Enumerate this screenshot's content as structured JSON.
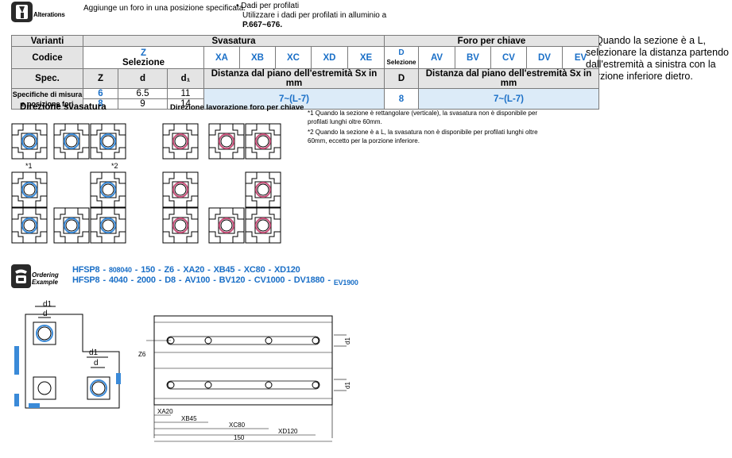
{
  "header": {
    "alterations_label": "Alterations",
    "description": "Aggiunge un foro in una posizione specificata.",
    "bullet_line1": "• Dadi per profilati",
    "bullet_line2": "Utilizzare i dadi per profilati in alluminio a",
    "bullet_line3": "P.667~676."
  },
  "side_note": {
    "icon": "question-icon",
    "text": "Quando la sezione è a L, selezionare la distanza partendo dall'estremità a sinistra con la porzione inferiore dietro."
  },
  "table": {
    "varianti": "Varianti",
    "svasatura": "Svasatura",
    "foro": "Foro per chiave",
    "codice": "Codice",
    "z": "Z",
    "selezione": "Selezione",
    "codes_sv": [
      "XA",
      "XB",
      "XC",
      "XD",
      "XE"
    ],
    "d": "D",
    "selezione_small": "Selezione",
    "codes_fk": [
      "AV",
      "BV",
      "CV",
      "DV",
      "EV"
    ],
    "spec": "Spec.",
    "col_z": "Z",
    "col_d": "d",
    "col_d1": "d₁",
    "dist_sv": "Distanza dal piano dell'estremità Sx in mm",
    "col_D": "D",
    "dist_fk": "Distanza dal piano dell'estremità Sx in mm",
    "spec_label1": "Specifiche di misura",
    "spec_label2": "e posizione fori",
    "rows": [
      {
        "z": "6",
        "d": "6.5",
        "d1": "11"
      },
      {
        "z": "8",
        "d": "9",
        "d1": "14"
      }
    ],
    "range_sv": "7~(L-7)",
    "D_val": "8",
    "range_fk": "7~(L-7)"
  },
  "sections": {
    "dir_sv": "Direzione svasatura",
    "dir_fk": "Direzione lavorazione foro per chiave",
    "mark1": "*1",
    "mark2": "*2"
  },
  "notes": {
    "n1": "*1 Quando la sezione è rettangolare (verticale), la svasatura non è disponibile per profilati lunghi oltre 60mm.",
    "n2": "*2 Quando la sezione è a L, la svasatura non è disponibile per profilati lunghi oltre 60mm, eccetto per la porzione inferiore."
  },
  "ordering": {
    "label1": "Ordering",
    "label2": "Example",
    "line1": [
      "HFSP8",
      "808040",
      "150",
      "Z6",
      "XA20",
      "XB45",
      "XC80",
      "XD120"
    ],
    "line2": [
      "HFSP8",
      "4040",
      "2000",
      "D8",
      "AV100",
      "BV120",
      "CV1000",
      "DV1880",
      "EV1900"
    ],
    "sep": "-"
  },
  "drawing": {
    "d1": "d1",
    "d": "d",
    "z6": "Z6",
    "xa20": "XA20",
    "xb45": "XB45",
    "xc80": "XC80",
    "xd120": "XD120",
    "len150": "150"
  }
}
